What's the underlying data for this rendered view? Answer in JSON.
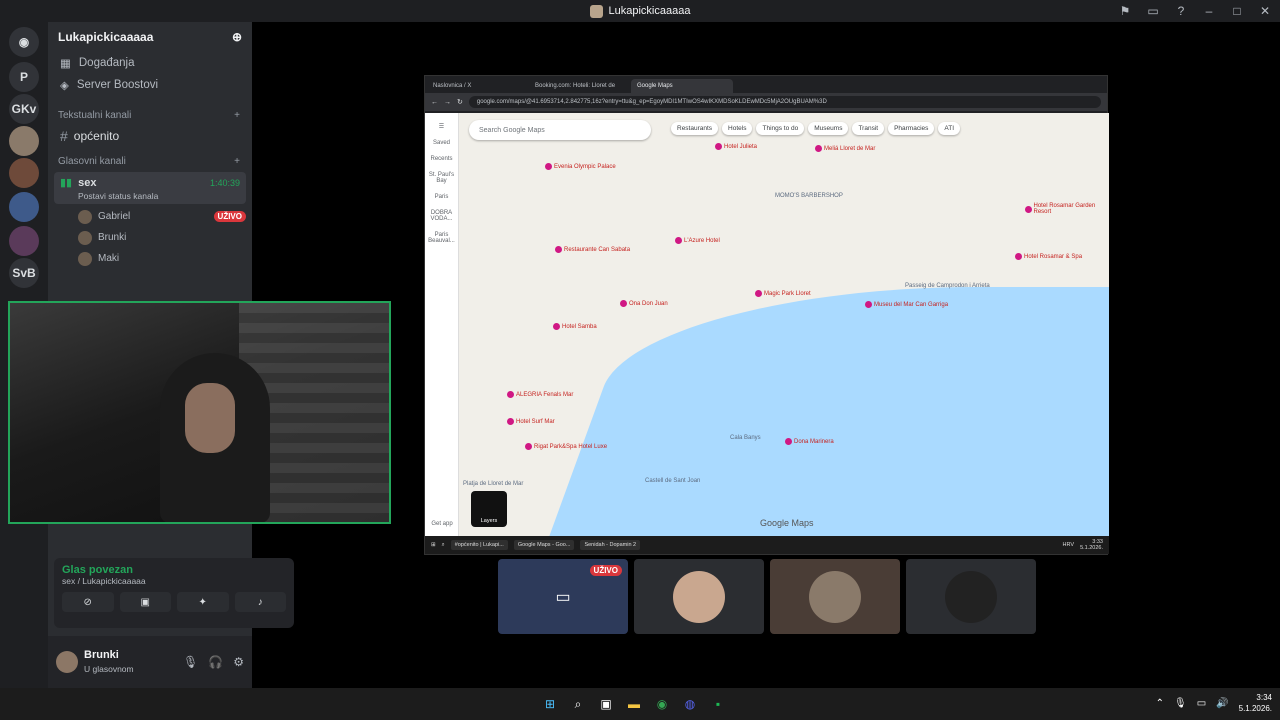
{
  "window": {
    "title": "Lukapickicaaaaa"
  },
  "guilds": [
    {
      "label": "P"
    },
    {
      "label": "GKv"
    },
    {
      "label": "SvB"
    }
  ],
  "server": {
    "name": "Lukapickicaaaaa"
  },
  "sidebar": {
    "events": "Događanja",
    "boosts": "Server Boostovi",
    "text_category": "Tekstualni kanali",
    "text_channel": "općenito",
    "voice_category": "Glasovni kanali"
  },
  "voice_channel": {
    "name": "sex",
    "timer": "1:40:39",
    "status": "Postavi status kanala",
    "users": [
      {
        "name": "Gabriel",
        "live": "UŽIVO"
      },
      {
        "name": "Brunki",
        "live": ""
      },
      {
        "name": "Maki",
        "live": ""
      }
    ]
  },
  "voice_panel": {
    "status": "Glas povezan",
    "channel": "sex / Lukapickicaaaaa"
  },
  "user_panel": {
    "name": "Brunki",
    "status": "U glasovnom"
  },
  "stream": {
    "tabs": [
      "Naslovnica / X",
      "Booking.com: Hoteli: Lloret de",
      "Google Maps"
    ],
    "url": "google.com/maps/@41.6953714,2.842775,16z?entry=ttu&g_ep=EgoyMDI1MTIwOS4wIKXMDSoKLDEwMDc5MjA2OUgBUAM%3D",
    "search_placeholder": "Search Google Maps",
    "chips": [
      "Restaurants",
      "Hotels",
      "Things to do",
      "Museums",
      "Transit",
      "Pharmacies",
      "ATI"
    ],
    "left_nav": [
      "Saved",
      "Recents",
      "St. Paul's Bay",
      "Paris",
      "DOBRA VODA...",
      "Paris Beauval..."
    ],
    "get_app": "Get app",
    "layers": "Layers",
    "labels": [
      "Evenia Olympic Palace",
      "Hotel Julieta",
      "Meliá Lloret de Mar",
      "MOMO'S BARBERSHOP",
      "Hotel Rosamar Garden Resort",
      "Restaurante Can Sabata",
      "L'Azure Hotel",
      "Magic Park Lloret",
      "Ona Don Juan",
      "Hotel Samba",
      "Museu del Mar Can Garriga",
      "ALEGRIA Fenals Mar",
      "Hotel Surf Mar",
      "Rigat Park&Spa Hotel Luxe",
      "Cala Banys",
      "Dona Marinera",
      "Castell de Sant Joan",
      "Platja de Lloret de Mar",
      "Passeig de Camprodon i Arrieta",
      "Hotel Rosamar & Spa",
      "Google Maps"
    ],
    "taskbar_apps": [
      "#općenito | Lukapi...",
      "Google Maps - Goo...",
      "Senidah - Dopamin 2"
    ],
    "taskbar_lang": "HRV",
    "taskbar_time": "3:33",
    "taskbar_date": "5.1.2026."
  },
  "tiles": [
    {
      "badge": "UŽIVO"
    },
    {
      "badge": ""
    },
    {
      "badge": ""
    },
    {
      "badge": ""
    }
  ],
  "taskbar": {
    "time": "3:34",
    "date": "5.1.2026."
  }
}
